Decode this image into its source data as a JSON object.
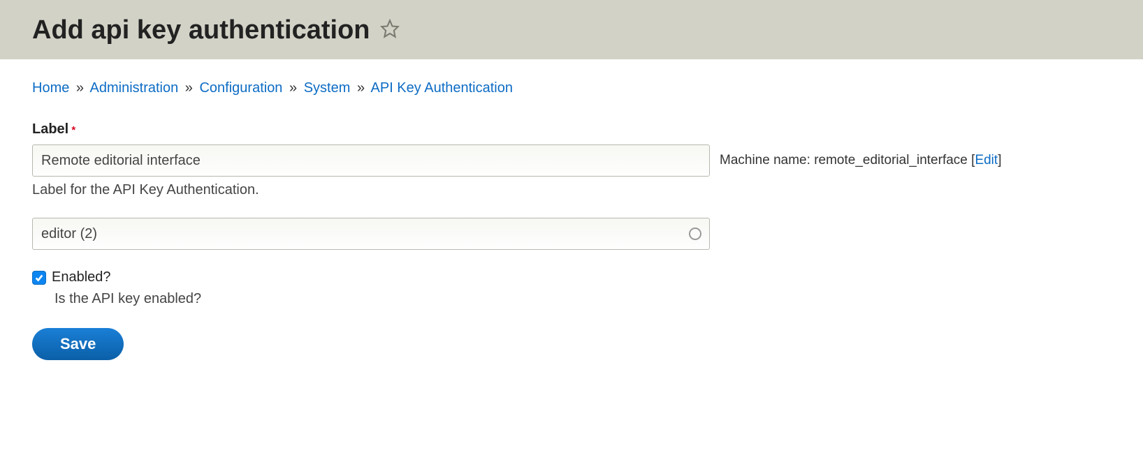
{
  "header": {
    "title": "Add api key authentication"
  },
  "breadcrumb": {
    "items": [
      {
        "label": "Home"
      },
      {
        "label": "Administration"
      },
      {
        "label": "Configuration"
      },
      {
        "label": "System"
      },
      {
        "label": "API Key Authentication"
      }
    ],
    "separator": "»"
  },
  "form": {
    "label_field": {
      "label": "Label",
      "required_marker": "*",
      "value": "Remote editorial interface",
      "description": "Label for the API Key Authentication."
    },
    "machine_name": {
      "prefix": "Machine name: ",
      "value": "remote_editorial_interface",
      "edit_label": "Edit",
      "open_bracket": "[",
      "close_bracket": "]"
    },
    "user_field": {
      "value": "editor (2)"
    },
    "enabled_field": {
      "label": "Enabled?",
      "checked": true,
      "description": "Is the API key enabled?"
    },
    "save_button": "Save"
  }
}
